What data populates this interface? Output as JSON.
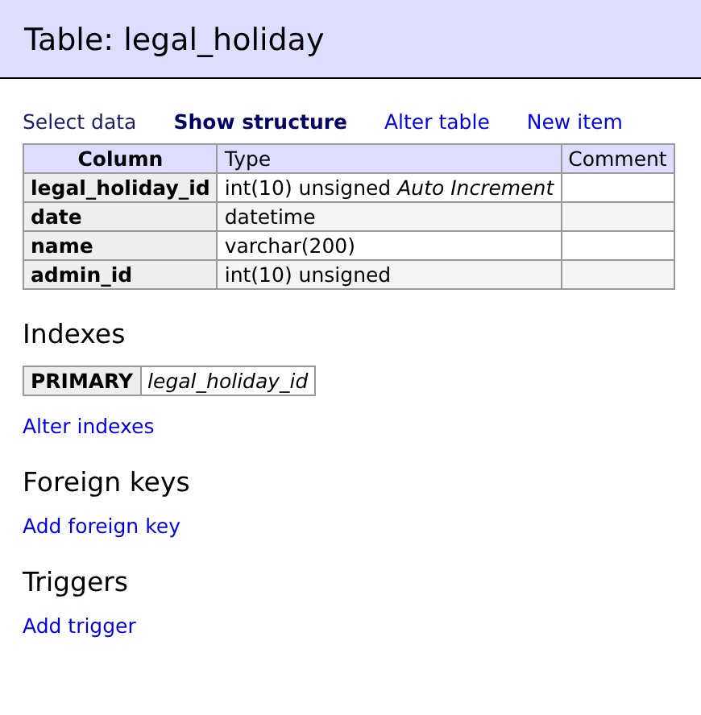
{
  "header": {
    "title": "Table: legal_holiday"
  },
  "nav": [
    {
      "label": "Select data",
      "selected": false,
      "visited": true
    },
    {
      "label": "Show structure",
      "selected": true,
      "visited": false
    },
    {
      "label": "Alter table",
      "selected": false,
      "visited": false
    },
    {
      "label": "New item",
      "selected": false,
      "visited": false
    }
  ],
  "table": {
    "columns": [
      "Column",
      "Type",
      "Comment"
    ],
    "rows": [
      {
        "column": "legal_holiday_id",
        "type": "int(10) unsigned *Auto Increment*"
      },
      {
        "column": "date",
        "type": "datetime"
      },
      {
        "column": "name",
        "type": "varchar(200)"
      },
      {
        "column": "admin_id",
        "type": "int(10) unsigned"
      }
    ]
  },
  "sections": [
    {
      "title": "Indexes",
      "indexes": [
        {
          "type": "PRIMARY",
          "columns": "legal_holiday_id"
        }
      ],
      "link": "Alter indexes"
    },
    {
      "title": "Foreign keys",
      "link": "Add foreign key"
    },
    {
      "title": "Triggers",
      "link": "Add trigger"
    }
  ]
}
